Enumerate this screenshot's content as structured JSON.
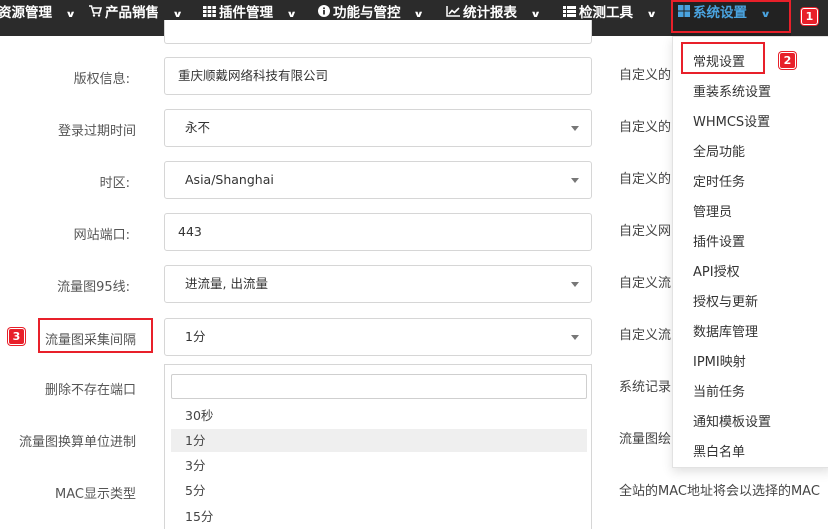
{
  "nav": {
    "items": [
      {
        "label": "资源管理",
        "icon": "",
        "chevron": "⌄"
      },
      {
        "label": "产品销售",
        "icon": "cart-icon",
        "chevron": "⌄"
      },
      {
        "label": "插件管理",
        "icon": "grid-icon",
        "chevron": "⌄"
      },
      {
        "label": "功能与管控",
        "icon": "info-icon",
        "chevron": "⌄"
      },
      {
        "label": "统计报表",
        "icon": "line-chart-icon",
        "chevron": "⌄"
      },
      {
        "label": "检测工具",
        "icon": "list-icon",
        "chevron": "⌄"
      },
      {
        "label": "系统设置",
        "icon": "windows-icon",
        "chevron": "⌄"
      }
    ],
    "active": "系统设置"
  },
  "annotations": {
    "badge1": "1",
    "badge2": "2",
    "badge3": "3"
  },
  "form": {
    "copyright": {
      "label": "版权信息:",
      "value": "重庆顺戴网络科技有限公司"
    },
    "login_expire": {
      "label": "登录过期时间",
      "value": "永不"
    },
    "timezone": {
      "label": "时区:",
      "value": "Asia/Shanghai"
    },
    "site_port": {
      "label": "网站端口:",
      "value": "443"
    },
    "traffic95": {
      "label": "流量图95线:",
      "value": "进流量, 出流量"
    },
    "traffic_interval": {
      "label": "流量图采集间隔",
      "value": "1分"
    },
    "delete_port": {
      "label": "删除不存在端口"
    },
    "traffic_unit": {
      "label": "流量图换算单位进制"
    },
    "mac_type": {
      "label": "MAC显示类型"
    }
  },
  "interval_options": [
    "30秒",
    "1分",
    "3分",
    "5分",
    "15分"
  ],
  "interval_selected": "1分",
  "right_texts": [
    "自定义的",
    "自定义的",
    "自定义的",
    "自定义网",
    "自定义流",
    "自定义流",
    "系统记录",
    "流量图绘",
    "全站的MAC地址将会以选择的MAC"
  ],
  "sys_menu": [
    "常规设置",
    "重装系统设置",
    "WHMCS设置",
    "全局功能",
    "定时任务",
    "管理员",
    "插件设置",
    "API授权",
    "授权与更新",
    "数据库管理",
    "IPMI映射",
    "当前任务",
    "通知模板设置",
    "黑白名单"
  ],
  "colors": {
    "nav_bg": "#2b2b2b",
    "active_text": "#4aa3df",
    "callout": "#e8202a"
  }
}
